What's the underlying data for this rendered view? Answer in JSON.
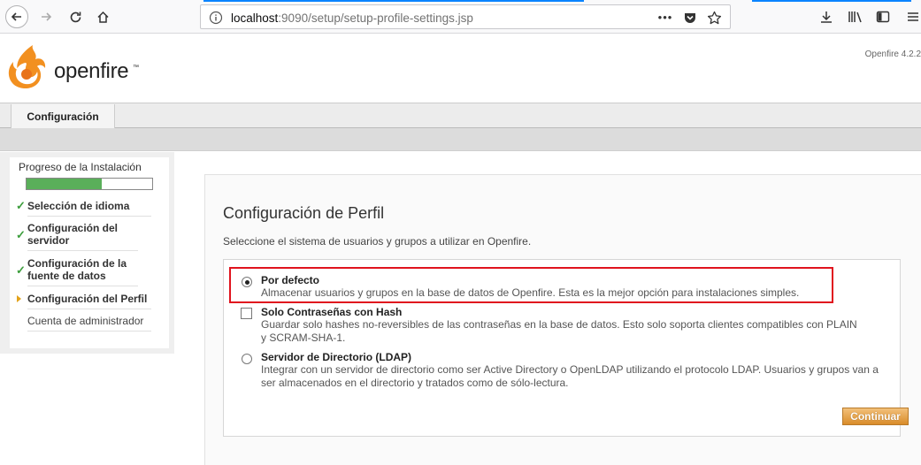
{
  "browser": {
    "url_host": "localhost",
    "url_rest": ":9090/setup/setup-profile-settings.jsp",
    "more_label": "•••",
    "accent": "#0a84ff"
  },
  "header": {
    "logo_text": "openfire",
    "logo_tm": "™",
    "version": "Openfire 4.2.2"
  },
  "tabs": [
    {
      "label": "Configuración"
    }
  ],
  "sidebar": {
    "progress_title": "Progreso de la Instalación",
    "progress_fraction": 0.6,
    "steps": [
      {
        "label": "Selección de idioma",
        "state": "done"
      },
      {
        "label": "Configuración del servidor",
        "state": "done"
      },
      {
        "label": "Configuración de la fuente de datos",
        "state": "done"
      },
      {
        "label": "Configuración del Perfil",
        "state": "current"
      },
      {
        "label": "Cuenta de administrador",
        "state": "pending"
      }
    ]
  },
  "main": {
    "title": "Configuración de Perfil",
    "description": "Seleccione el sistema de usuarios y grupos a utilizar en Openfire.",
    "options": [
      {
        "title": "Por defecto",
        "description": "Almacenar usuarios y grupos en la base de datos de Openfire. Esta es la mejor opción para instalaciones simples.",
        "control": "radio",
        "selected": true
      },
      {
        "title": "Solo Contraseñas con Hash",
        "description_lines": [
          "Guardar solo hashes no-reversibles de las contraseñas en la base de datos. Esto solo soporta clientes compatibles con PLAIN",
          "y SCRAM-SHA-1."
        ],
        "control": "checkbox",
        "selected": false
      },
      {
        "title": "Servidor de Directorio (LDAP)",
        "description_lines": [
          "Integrar con un servidor de directorio como ser Active Directory o OpenLDAP utilizando el protocolo LDAP. Usuarios y grupos van a",
          "ser almacenados en el directorio y tratados como de sólo-lectura."
        ],
        "control": "radio",
        "selected": false
      }
    ],
    "continue_label": "Continuar",
    "highlight_color": "#e0141e"
  }
}
